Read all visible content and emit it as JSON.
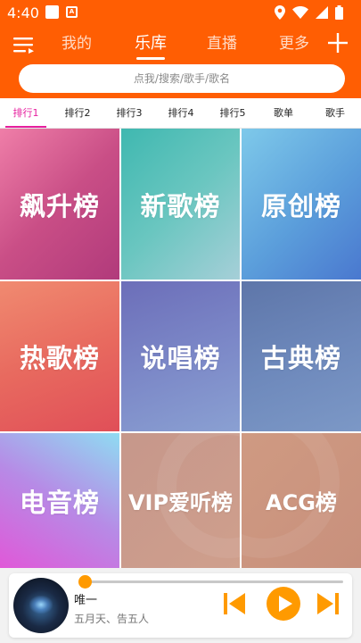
{
  "status_bar": {
    "time": "4:40",
    "icons": [
      "notification-square-icon",
      "a-box-icon",
      "location-icon",
      "wifi-icon",
      "signal-icon",
      "battery-icon"
    ]
  },
  "top_nav": {
    "menu_icon": "menu-icon",
    "tabs": [
      {
        "label": "我的",
        "active": false
      },
      {
        "label": "乐库",
        "active": true
      },
      {
        "label": "直播",
        "active": false
      },
      {
        "label": "更多",
        "active": false
      }
    ],
    "add_icon": "plus-icon"
  },
  "search": {
    "placeholder": "点我/搜索/歌手/歌名"
  },
  "category_tabs": [
    {
      "label": "排行1",
      "active": true
    },
    {
      "label": "排行2",
      "active": false
    },
    {
      "label": "排行3",
      "active": false
    },
    {
      "label": "排行4",
      "active": false
    },
    {
      "label": "排行5",
      "active": false
    },
    {
      "label": "歌单",
      "active": false
    },
    {
      "label": "歌手",
      "active": false
    }
  ],
  "grid": {
    "tiles": [
      {
        "label": "飙升榜"
      },
      {
        "label": "新歌榜"
      },
      {
        "label": "原创榜"
      },
      {
        "label": "热歌榜"
      },
      {
        "label": "说唱榜"
      },
      {
        "label": "古典榜"
      },
      {
        "label": "电音榜"
      },
      {
        "label": "VIP爱听榜"
      },
      {
        "label": "ACG榜"
      }
    ]
  },
  "player": {
    "song_title": "唯一",
    "artist": "五月天、告五人",
    "progress": 0.02,
    "controls": [
      "previous-icon",
      "play-icon",
      "next-icon"
    ]
  },
  "colors": {
    "header": "#ff5e03",
    "accent_tab": "#e61e9e",
    "player_accent": "#ff9a00"
  }
}
